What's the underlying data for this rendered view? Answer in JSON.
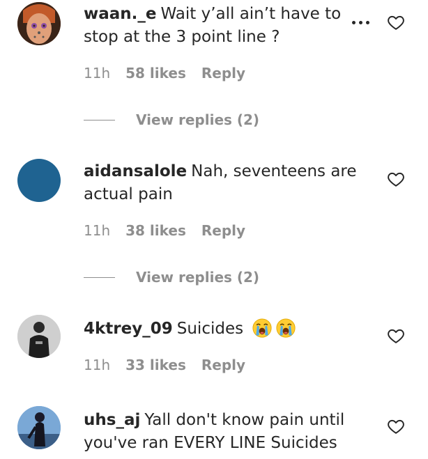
{
  "comments": [
    {
      "username": "waan._e",
      "text": "Wait y’all ain’t have to stop at the 3 point line ?",
      "time": "11h",
      "likes": "58 likes",
      "reply": "Reply",
      "view_replies": "View replies (2)",
      "avatar": "pain-avatar"
    },
    {
      "username": "aidansalole",
      "text": "Nah, seventeens are actual pain",
      "time": "11h",
      "likes": "38 likes",
      "reply": "Reply",
      "view_replies": "View replies (2)",
      "avatar_color": "#1f6391"
    },
    {
      "username": "4ktrey_09",
      "text": "Suicides",
      "time": "11h",
      "likes": "33 likes",
      "reply": "Reply",
      "emojis": [
        "loudly-crying-face-icon",
        "loudly-crying-face-icon"
      ]
    },
    {
      "username": "uhs_aj",
      "text": "Yall don't know pain until you've ran EVERY LINE Suicides"
    }
  ],
  "icons": {
    "like": "heart-outline-icon",
    "more": "more-options-icon"
  }
}
